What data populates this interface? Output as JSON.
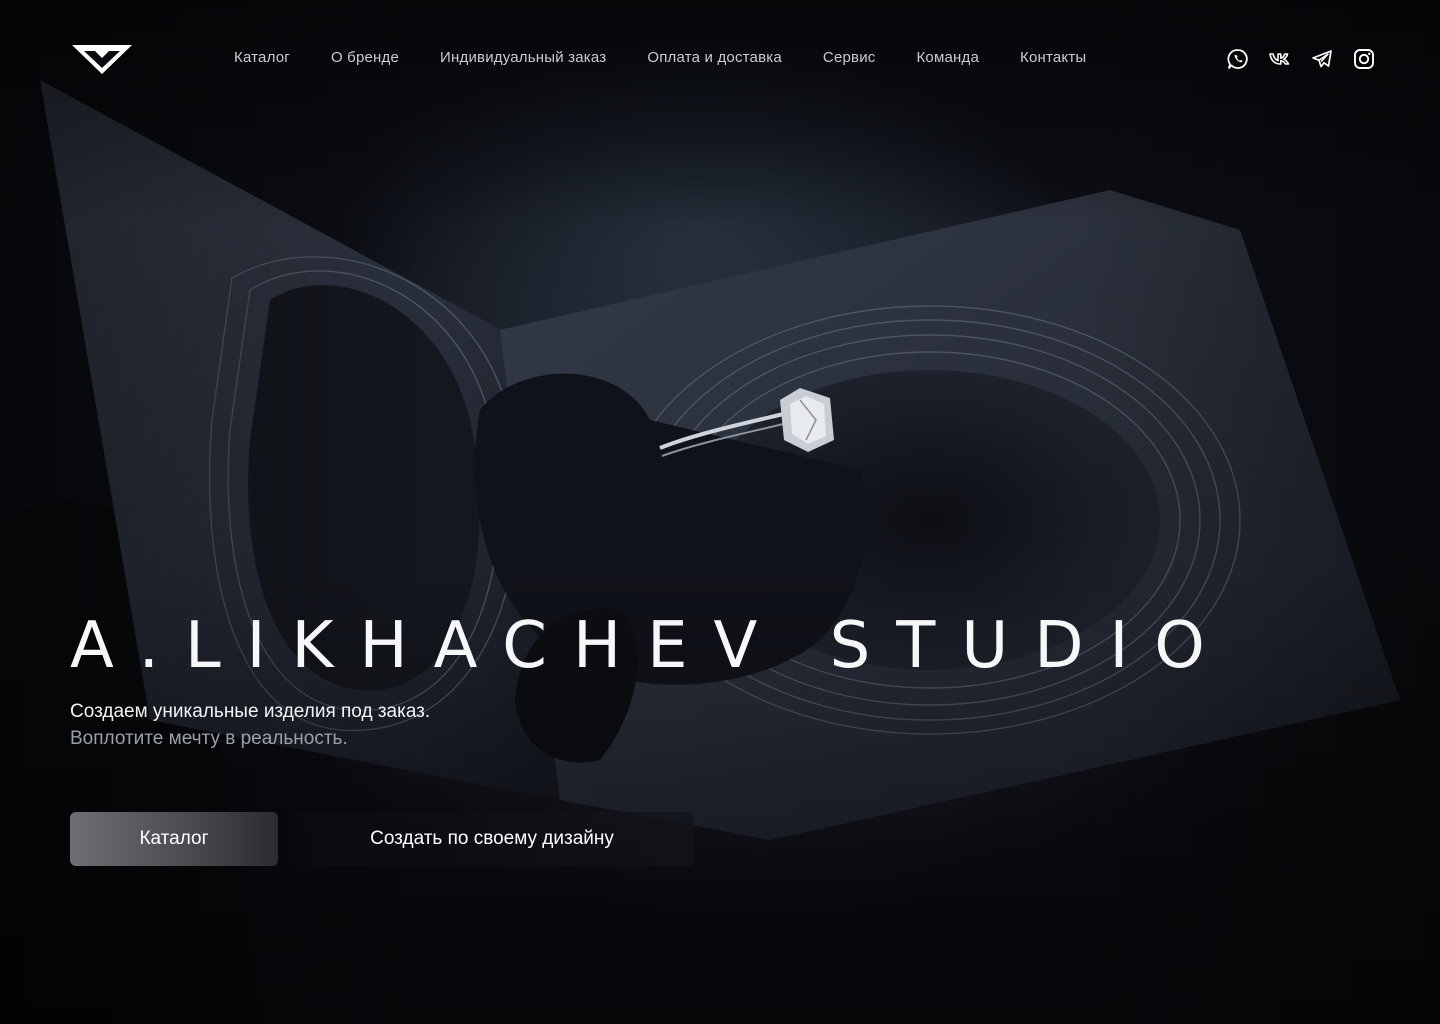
{
  "brand": {
    "logo_icon": "diamond-v-logo-icon"
  },
  "nav": {
    "items": [
      {
        "label": "Каталог"
      },
      {
        "label": "О бренде"
      },
      {
        "label": "Индивидуальный заказ"
      },
      {
        "label": "Оплата и доставка"
      },
      {
        "label": "Сервис"
      },
      {
        "label": "Команда"
      },
      {
        "label": "Контакты"
      }
    ]
  },
  "socials": [
    {
      "icon": "whatsapp-icon"
    },
    {
      "icon": "vk-icon"
    },
    {
      "icon": "telegram-icon"
    },
    {
      "icon": "instagram-icon"
    }
  ],
  "hero": {
    "title": "A.LIKHACHEV STUDIO",
    "subtitle_line1": "Создаем уникальные изделия под заказ.",
    "subtitle_line2": "Воплотите мечту в реальность.",
    "primary_button": "Каталог",
    "secondary_button": "Создать по своему дизайну",
    "background_image": "ring-in-black-box-photo"
  },
  "colors": {
    "text_primary": "#f6f7f9",
    "text_muted": "#9aa0a9",
    "nav_text": "#c9ccd2",
    "background": "#0b0d12"
  }
}
